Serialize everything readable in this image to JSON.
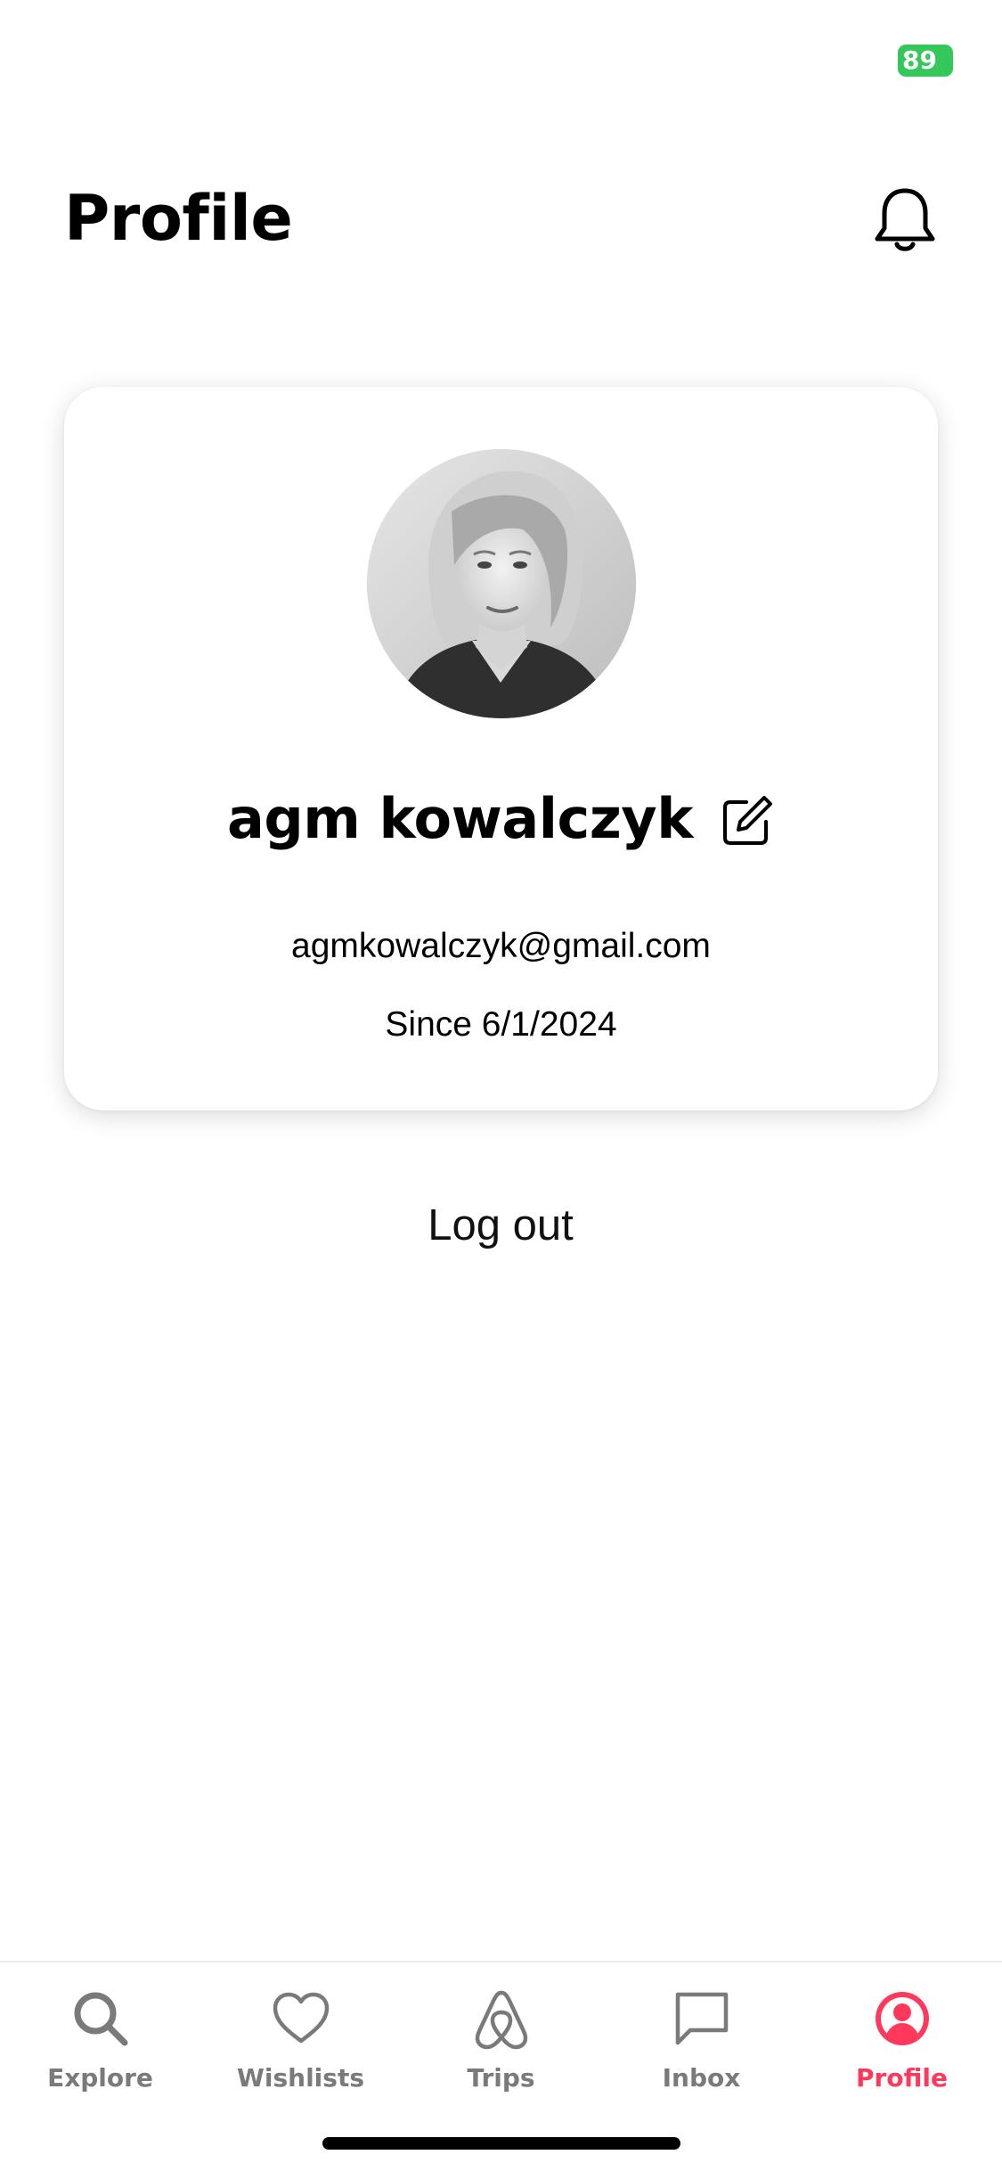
{
  "status_bar": {
    "battery_level": "89"
  },
  "header": {
    "title": "Profile",
    "notification_icon": "bell-icon"
  },
  "profile_card": {
    "name": "agm kowalczyk",
    "edit_icon": "edit-icon",
    "email": "agmkowalczyk@gmail.com",
    "member_since": "Since 6/1/2024"
  },
  "actions": {
    "logout_label": "Log out"
  },
  "tab_bar": {
    "active_tab": "Profile",
    "accent_color": "#ff385c",
    "inactive_color": "#7a7a7a",
    "tabs": [
      {
        "label": "Explore",
        "icon": "search-icon"
      },
      {
        "label": "Wishlists",
        "icon": "heart-icon"
      },
      {
        "label": "Trips",
        "icon": "airbnb-logo-icon"
      },
      {
        "label": "Inbox",
        "icon": "message-icon"
      },
      {
        "label": "Profile",
        "icon": "user-circle-icon"
      }
    ]
  }
}
